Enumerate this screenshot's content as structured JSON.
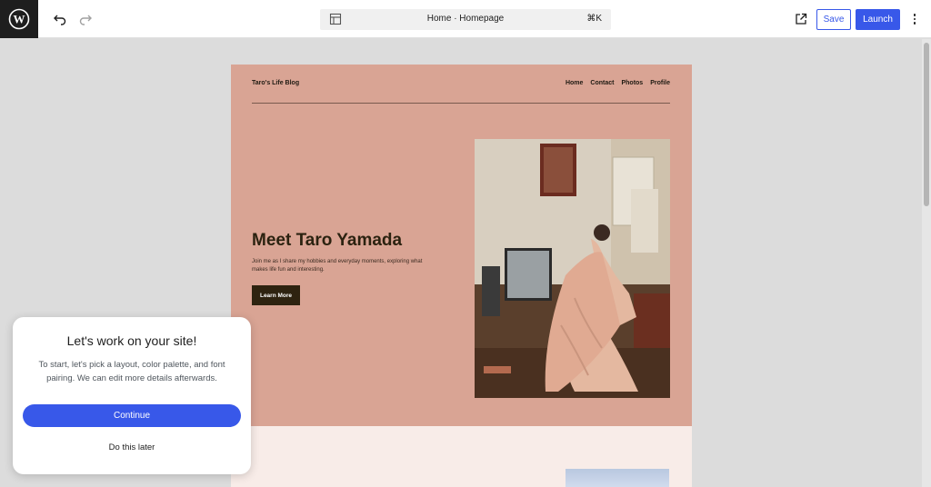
{
  "toolbar": {
    "logo": "wordpress-logo",
    "undo_icon": "undo-icon",
    "redo_icon": "redo-icon",
    "document_title": "Home · Homepage",
    "shortcut": "⌘K",
    "view_icon": "external-link-icon",
    "save_label": "Save",
    "launch_label": "Launch",
    "more_icon": "more-vertical-icon"
  },
  "site": {
    "title": "Taro's Life Blog",
    "nav": [
      "Home",
      "Contact",
      "Photos",
      "Profile"
    ],
    "hero_title": "Meet Taro Yamada",
    "hero_text": "Join me as I share my hobbies and everyday moments, exploring what makes life fun and interesting.",
    "hero_button": "Learn More"
  },
  "dialog": {
    "title": "Let's work on your site!",
    "body": "To start, let's pick a layout, color palette, and font pairing. We can edit more details afterwards.",
    "continue_label": "Continue",
    "later_label": "Do this later"
  },
  "colors": {
    "accent": "#3858e9",
    "hero_bg": "#d9a494",
    "lower_bg": "#f8ece8",
    "hero_button_bg": "#2e2310"
  }
}
